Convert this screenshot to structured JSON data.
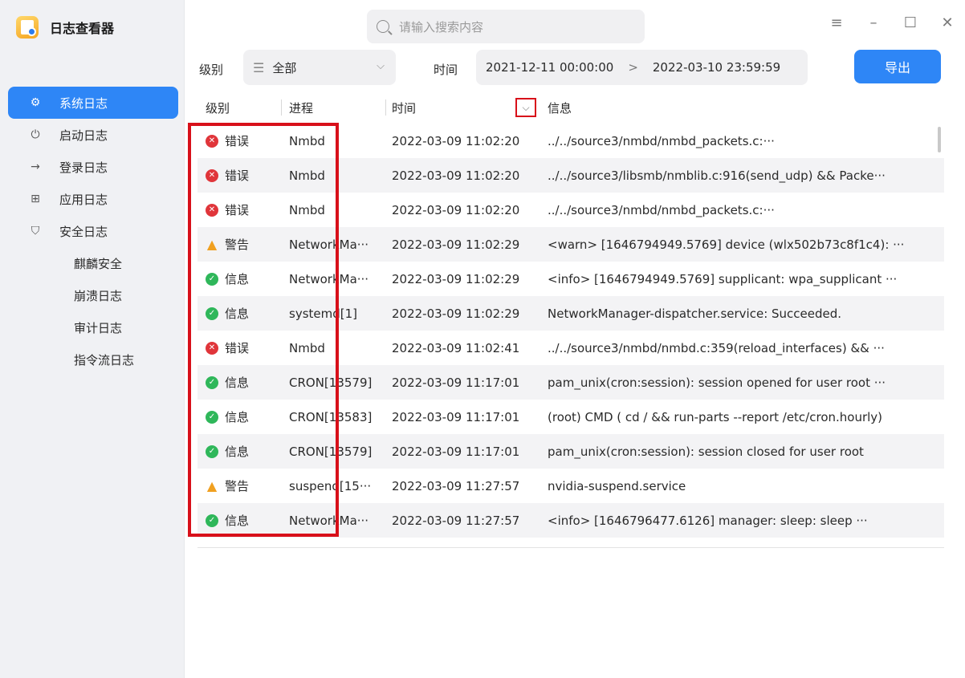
{
  "app": {
    "name": "日志查看器"
  },
  "search": {
    "placeholder": "请输入搜索内容"
  },
  "sidebar": {
    "items": [
      {
        "label": "系统日志",
        "icon": "gear-icon",
        "active": true
      },
      {
        "label": "启动日志",
        "icon": "power-icon"
      },
      {
        "label": "登录日志",
        "icon": "login-icon"
      },
      {
        "label": "应用日志",
        "icon": "apps-grid-icon"
      },
      {
        "label": "安全日志",
        "icon": "shield-icon"
      }
    ],
    "subitems": [
      "麒麟安全",
      "崩溃日志",
      "审计日志",
      "指令流日志"
    ]
  },
  "filters": {
    "level_label": "级别",
    "level_value": "全部",
    "time_label": "时间",
    "date_from": "2021-12-11 00:00:00",
    "date_sep": ">",
    "date_to": "2022-03-10 23:59:59",
    "export_label": "导出"
  },
  "table": {
    "headers": {
      "level": "级别",
      "process": "进程",
      "time": "时间",
      "info": "信息"
    },
    "rows": [
      {
        "level": "错误",
        "type": "error",
        "process": "Nmbd",
        "time": "2022-03-09 11:02:20",
        "info": "../../source3/nmbd/nmbd_packets.c:···"
      },
      {
        "level": "错误",
        "type": "error",
        "process": "Nmbd",
        "time": "2022-03-09 11:02:20",
        "info": "../../source3/libsmb/nmblib.c:916(send_udp) && Packe···"
      },
      {
        "level": "错误",
        "type": "error",
        "process": "Nmbd",
        "time": "2022-03-09 11:02:20",
        "info": "../../source3/nmbd/nmbd_packets.c:···"
      },
      {
        "level": "警告",
        "type": "warn",
        "process": "NetworkMa···",
        "time": "2022-03-09 11:02:29",
        "info": "<warn> [1646794949.5769] device (wlx502b73c8f1c4): ···"
      },
      {
        "level": "信息",
        "type": "info",
        "process": "NetworkMa···",
        "time": "2022-03-09 11:02:29",
        "info": "<info> [1646794949.5769] supplicant: wpa_supplicant ···"
      },
      {
        "level": "信息",
        "type": "info",
        "process": "systemd[1]",
        "time": "2022-03-09 11:02:29",
        "info": "NetworkManager-dispatcher.service: Succeeded."
      },
      {
        "level": "错误",
        "type": "error",
        "process": "Nmbd",
        "time": "2022-03-09 11:02:41",
        "info": "../../source3/nmbd/nmbd.c:359(reload_interfaces) && ···"
      },
      {
        "level": "信息",
        "type": "info",
        "process": "CRON[13579]",
        "time": "2022-03-09 11:17:01",
        "info": "pam_unix(cron:session): session opened for user root ···"
      },
      {
        "level": "信息",
        "type": "info",
        "process": "CRON[13583]",
        "time": "2022-03-09 11:17:01",
        "info": "(root) CMD (   cd / && run-parts --report /etc/cron.hourly)"
      },
      {
        "level": "信息",
        "type": "info",
        "process": "CRON[13579]",
        "time": "2022-03-09 11:17:01",
        "info": "pam_unix(cron:session): session closed for user root"
      },
      {
        "level": "警告",
        "type": "warn",
        "process": "suspend[15···",
        "time": "2022-03-09 11:27:57",
        "info": "nvidia-suspend.service"
      },
      {
        "level": "信息",
        "type": "info",
        "process": "NetworkMa···",
        "time": "2022-03-09 11:27:57",
        "info": "<info> [1646796477.6126] manager: sleep: sleep ···"
      }
    ]
  },
  "colors": {
    "accent": "#2e86f6",
    "error": "#e0353a",
    "info": "#2fb75a",
    "warn": "#f0a020",
    "highlight": "#d8101a"
  }
}
